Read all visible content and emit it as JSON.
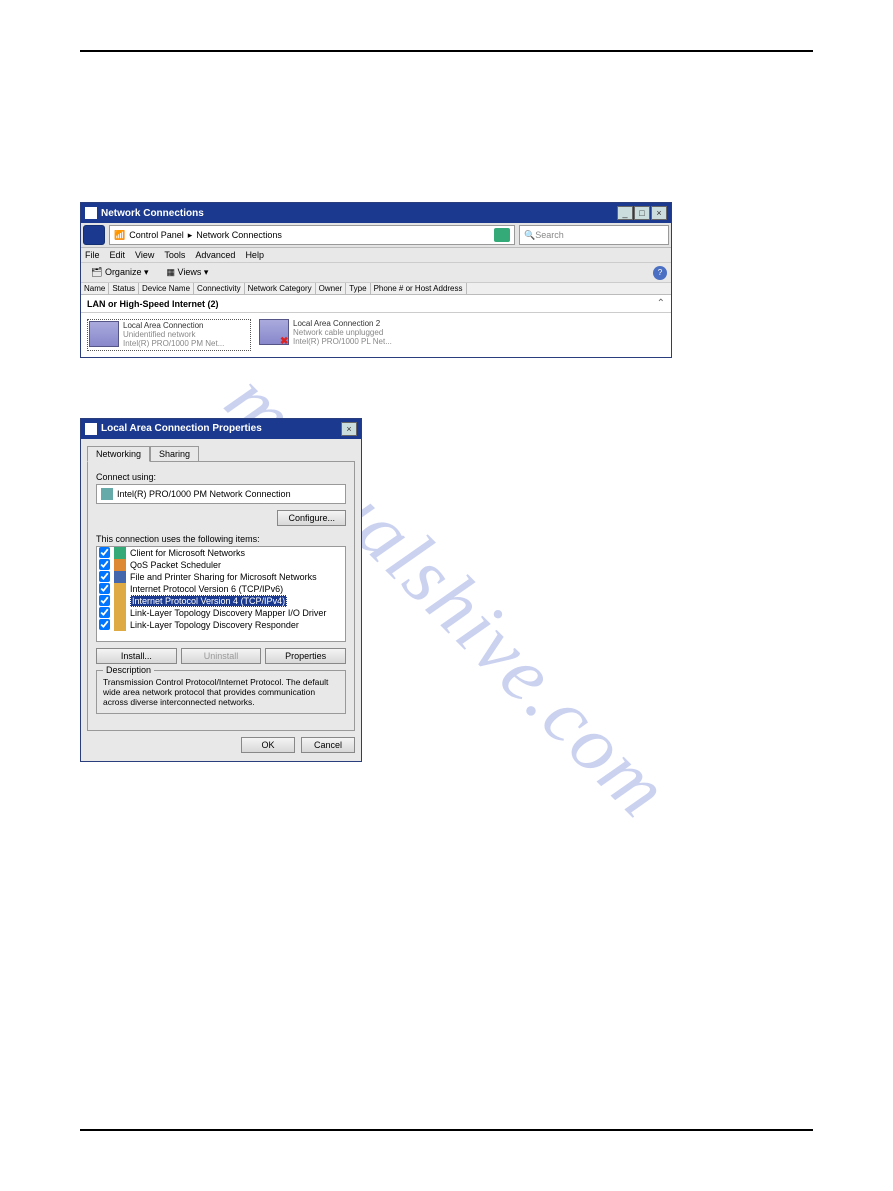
{
  "watermark": "manualshive.com",
  "win1": {
    "title": "Network Connections",
    "breadcrumb_prefix": "▸",
    "breadcrumb1": "Control Panel",
    "breadcrumb2": "Network Connections",
    "search_placeholder": "Search",
    "menu": {
      "file": "File",
      "edit": "Edit",
      "view": "View",
      "tools": "Tools",
      "advanced": "Advanced",
      "help": "Help"
    },
    "toolbar": {
      "organize": "Organize ▾",
      "views": "Views ▾"
    },
    "columns": [
      "Name",
      "Status",
      "Device Name",
      "Connectivity",
      "Network Category",
      "Owner",
      "Type",
      "Phone # or Host Address"
    ],
    "group_header": "LAN or High-Speed Internet (2)",
    "conn1": {
      "name": "Local Area Connection",
      "line2": "Unidentified network",
      "line3": "Intel(R) PRO/1000 PM Net..."
    },
    "conn2": {
      "name": "Local Area Connection 2",
      "line2": "Network cable unplugged",
      "line3": "Intel(R) PRO/1000 PL Net..."
    }
  },
  "dlg": {
    "title": "Local Area Connection Properties",
    "tab_networking": "Networking",
    "tab_sharing": "Sharing",
    "connect_using_lbl": "Connect using:",
    "adapter": "Intel(R) PRO/1000 PM Network Connection",
    "configure_btn": "Configure...",
    "uses_lbl": "This connection uses the following items:",
    "items": {
      "i0": "Client for Microsoft Networks",
      "i1": "QoS Packet Scheduler",
      "i2": "File and Printer Sharing for Microsoft Networks",
      "i3": "Internet Protocol Version 6 (TCP/IPv6)",
      "i4": "Internet Protocol Version 4 (TCP/IPv4)",
      "i5": "Link-Layer Topology Discovery Mapper I/O Driver",
      "i6": "Link-Layer Topology Discovery Responder"
    },
    "install_btn": "Install...",
    "uninstall_btn": "Uninstall",
    "properties_btn": "Properties",
    "desc_legend": "Description",
    "desc_text": "Transmission Control Protocol/Internet Protocol. The default wide area network protocol that provides communication across diverse interconnected networks.",
    "ok_btn": "OK",
    "cancel_btn": "Cancel"
  }
}
